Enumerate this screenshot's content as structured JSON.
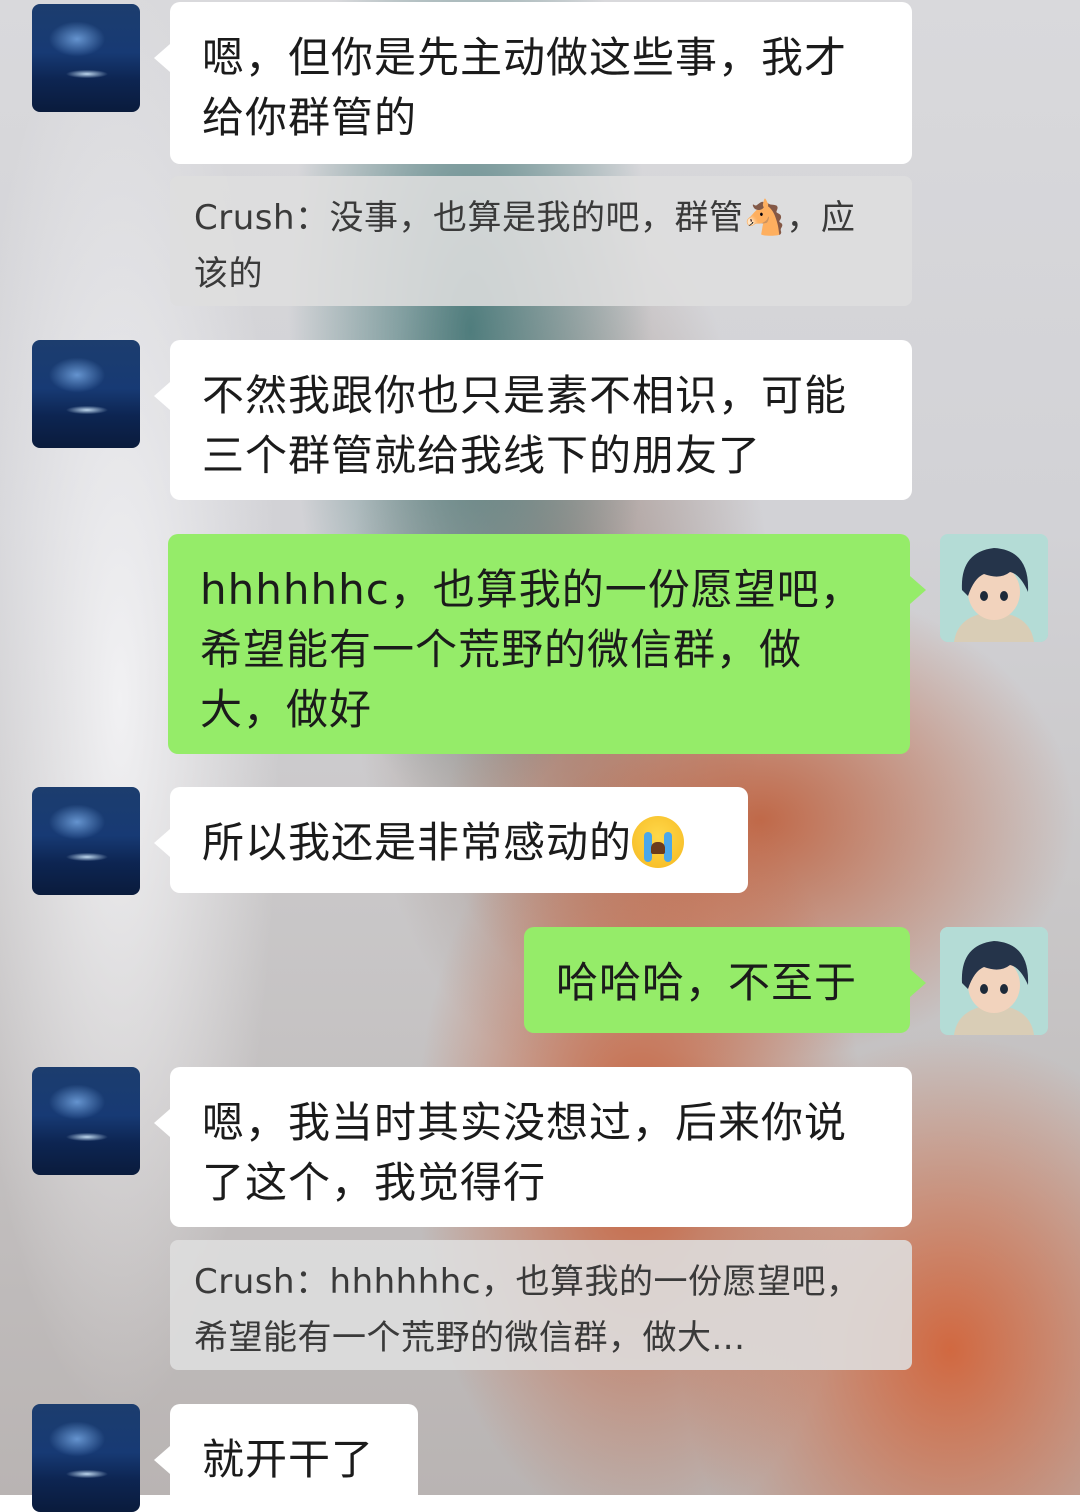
{
  "messages": [
    {
      "sender": "other",
      "text": "嗯，但你是先主动做这些事，我才给你群管的"
    },
    {
      "sender": "other",
      "quote": "Crush：没事，也算是我的吧，群管🐴，应该的"
    },
    {
      "sender": "other",
      "text": "不然我跟你也只是素不相识，可能三个群管就给我线下的朋友了"
    },
    {
      "sender": "self",
      "text": "hhhhhhc，也算我的一份愿望吧，希望能有一个荒野的微信群，做大，做好"
    },
    {
      "sender": "other",
      "text": "所以我还是非常感动的",
      "emoji": "loudly-crying-face"
    },
    {
      "sender": "self",
      "text": "哈哈哈，不至于"
    },
    {
      "sender": "other",
      "text": "嗯，我当时其实没想过，后来你说了这个，我觉得行"
    },
    {
      "sender": "other",
      "quote": "Crush：hhhhhhc，也算我的一份愿望吧，希望能有一个荒野的微信群，做大..."
    },
    {
      "sender": "other",
      "text": "就开干了"
    }
  ],
  "colors": {
    "self_bubble": "#95ec69",
    "other_bubble": "#ffffff",
    "quote_bubble": "#dedede"
  }
}
